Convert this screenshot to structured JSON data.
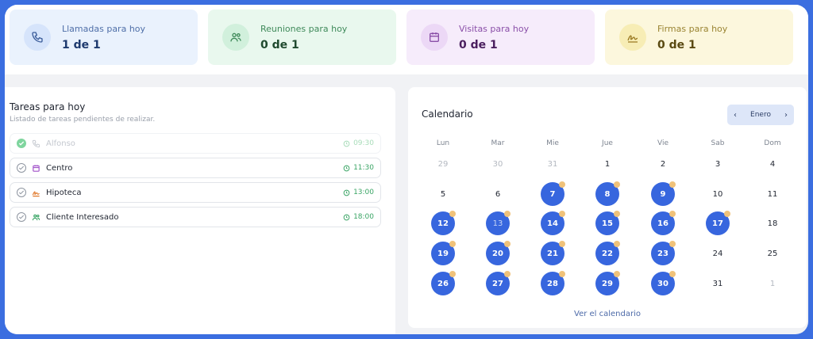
{
  "stats": [
    {
      "label": "Llamadas para hoy",
      "value": "1 de 1",
      "icon": "phone-icon"
    },
    {
      "label": "Reuniones para hoy",
      "value": "0 de 1",
      "icon": "users-icon"
    },
    {
      "label": "Visitas para hoy",
      "value": "0 de 1",
      "icon": "calendar-icon"
    },
    {
      "label": "Firmas para hoy",
      "value": "0 de 1",
      "icon": "signature-icon"
    }
  ],
  "tasks": {
    "title": "Tareas para hoy",
    "subtitle": "Listado de tareas pendientes de realizar.",
    "items": [
      {
        "label": "Alfonso",
        "time": "09:30",
        "icon": "phone-icon",
        "done": true
      },
      {
        "label": "Centro",
        "time": "11:30",
        "icon": "calendar-icon",
        "done": false
      },
      {
        "label": "Hipoteca",
        "time": "13:00",
        "icon": "signature-icon",
        "done": false
      },
      {
        "label": "Cliente Interesado",
        "time": "18:00",
        "icon": "users-icon",
        "done": false
      }
    ]
  },
  "calendar": {
    "title": "Calendario",
    "month": "Enero",
    "weekdays": [
      "Lun",
      "Mar",
      "Mie",
      "Jue",
      "Vie",
      "Sab",
      "Dom"
    ],
    "weeks": [
      [
        {
          "d": "29",
          "muted": true
        },
        {
          "d": "30",
          "muted": true
        },
        {
          "d": "31",
          "muted": true
        },
        {
          "d": "1"
        },
        {
          "d": "2"
        },
        {
          "d": "3"
        },
        {
          "d": "4"
        }
      ],
      [
        {
          "d": "5"
        },
        {
          "d": "6"
        },
        {
          "d": "7",
          "event": true
        },
        {
          "d": "8",
          "event": true
        },
        {
          "d": "9",
          "event": true
        },
        {
          "d": "10"
        },
        {
          "d": "11"
        }
      ],
      [
        {
          "d": "12",
          "event": true
        },
        {
          "d": "13",
          "event": true,
          "faded": true
        },
        {
          "d": "14",
          "event": true
        },
        {
          "d": "15",
          "event": true
        },
        {
          "d": "16",
          "event": true
        },
        {
          "d": "17",
          "event": true
        },
        {
          "d": "18"
        }
      ],
      [
        {
          "d": "19",
          "event": true
        },
        {
          "d": "20",
          "event": true
        },
        {
          "d": "21",
          "event": true
        },
        {
          "d": "22",
          "event": true
        },
        {
          "d": "23",
          "event": true
        },
        {
          "d": "24"
        },
        {
          "d": "25"
        }
      ],
      [
        {
          "d": "26",
          "event": true
        },
        {
          "d": "27",
          "event": true
        },
        {
          "d": "28",
          "event": true
        },
        {
          "d": "29",
          "event": true
        },
        {
          "d": "30",
          "event": true
        },
        {
          "d": "31"
        },
        {
          "d": "1",
          "muted": true
        }
      ]
    ],
    "view_all": "Ver el calendario"
  }
}
